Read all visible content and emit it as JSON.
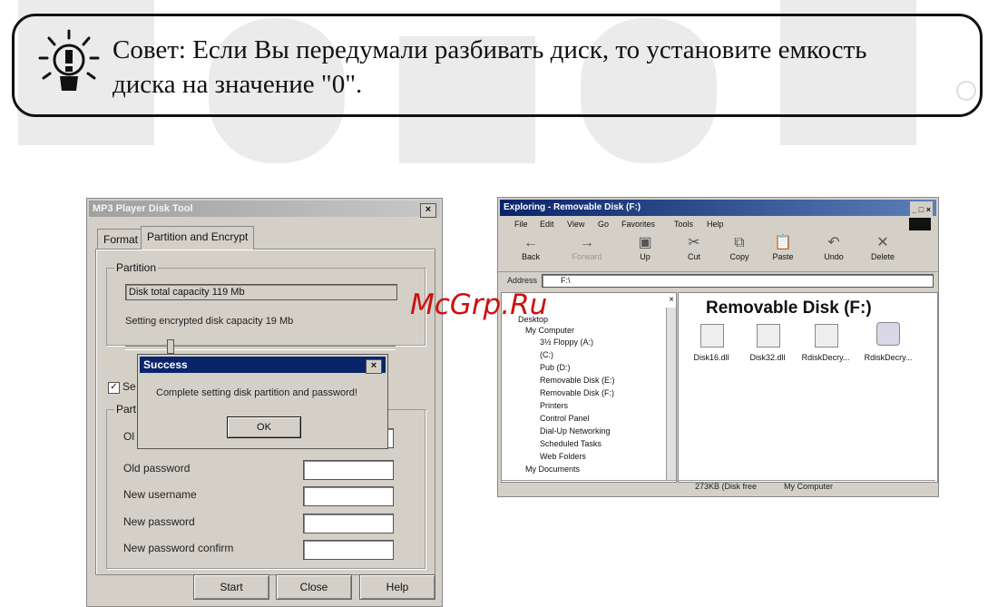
{
  "tip": {
    "text_line1": "Совет: Если Вы передумали разбивать диск, то установите емкость",
    "text_line2": "диска на значение \"0\"."
  },
  "watermark": {
    "brand": "texet",
    "overlay": "McGrp.Ru"
  },
  "disk_tool": {
    "title": "MP3 Player Disk Tool",
    "close": "×",
    "tabs": [
      "Format",
      "Partition and Encrypt"
    ],
    "partition_group": "Partition",
    "total_capacity": "Disk total capacity 119 Mb",
    "encrypted_capacity": "Setting encrypted disk capacity 19 Mb",
    "slider_fraction": 0.16,
    "checkbox_label_partial": "Se",
    "password_group_partial": "Part",
    "old_username_partial": "Ol",
    "old_password": "Old password",
    "new_username": "New username",
    "new_password": "New password",
    "new_password_confirm": "New password confirm",
    "buttons": {
      "start": "Start",
      "close": "Close",
      "help": "Help"
    }
  },
  "success_dialog": {
    "title": "Success",
    "message": "Complete setting disk partition and password!",
    "ok": "OK"
  },
  "explorer": {
    "title": "Exploring - Removable Disk (F:)",
    "menu": [
      "File",
      "Edit",
      "View",
      "Go",
      "Favorites",
      "Tools",
      "Help"
    ],
    "toolbar": [
      "Back",
      "Forward",
      "Up",
      "Cut",
      "Copy",
      "Paste",
      "Undo",
      "Delete"
    ],
    "address_label": "Address",
    "address_value": "F:\\",
    "heading": "Removable Disk (F:)",
    "tree": [
      "Desktop",
      "My Computer",
      "3½ Floppy (A:)",
      "(C:)",
      "Pub (D:)",
      "Removable Disk (E:)",
      "Removable Disk (F:)",
      "Printers",
      "Control Panel",
      "Dial-Up Networking",
      "Scheduled Tasks",
      "Web Folders",
      "My Documents"
    ],
    "files": [
      "Disk16.dll",
      "Disk32.dll",
      "RdiskDecry...",
      "RdiskDecry..."
    ],
    "status": "273KB (Disk free",
    "status_zone": "My Computer"
  }
}
